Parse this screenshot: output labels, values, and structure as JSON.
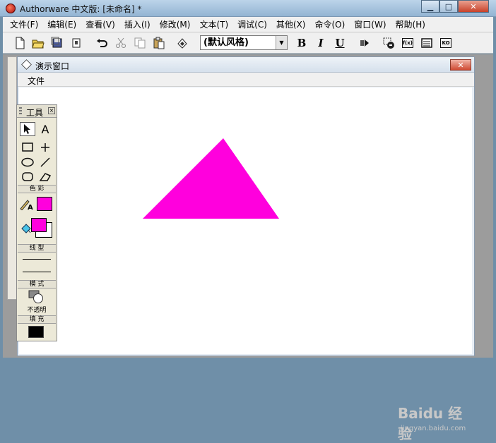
{
  "window": {
    "title": "Authorware 中文版: [未命名] *"
  },
  "menubar": {
    "items": [
      "文件(F)",
      "编辑(E)",
      "查看(V)",
      "插入(I)",
      "修改(M)",
      "文本(T)",
      "调试(C)",
      "其他(X)",
      "命令(O)",
      "窗口(W)",
      "帮助(H)"
    ]
  },
  "toolbar": {
    "style_select": "(默认风格)",
    "bold_label": "B",
    "italic_label": "I",
    "underline_label": "U",
    "func_label": "f(x)",
    "ko_label": "KO"
  },
  "presentation": {
    "title": "演示窗口",
    "menu_file": "文件",
    "triangle_color": "#ff00dd"
  },
  "tools": {
    "title": "工具",
    "pointer_icon": "arrow-pointer-icon",
    "text_label": "A",
    "color_section": "色 彩",
    "line_section": "线 型",
    "mode_section": "模 式",
    "mode_value": "不透明",
    "fill_section": "填 充",
    "pen_color": "#ff00dd",
    "fill_fg": "#ff00dd",
    "fill_bg": "#ffffff",
    "pattern_color": "#000000"
  },
  "watermark": {
    "logo": "Baidu 经验",
    "url": "jingyan.baidu.com"
  }
}
